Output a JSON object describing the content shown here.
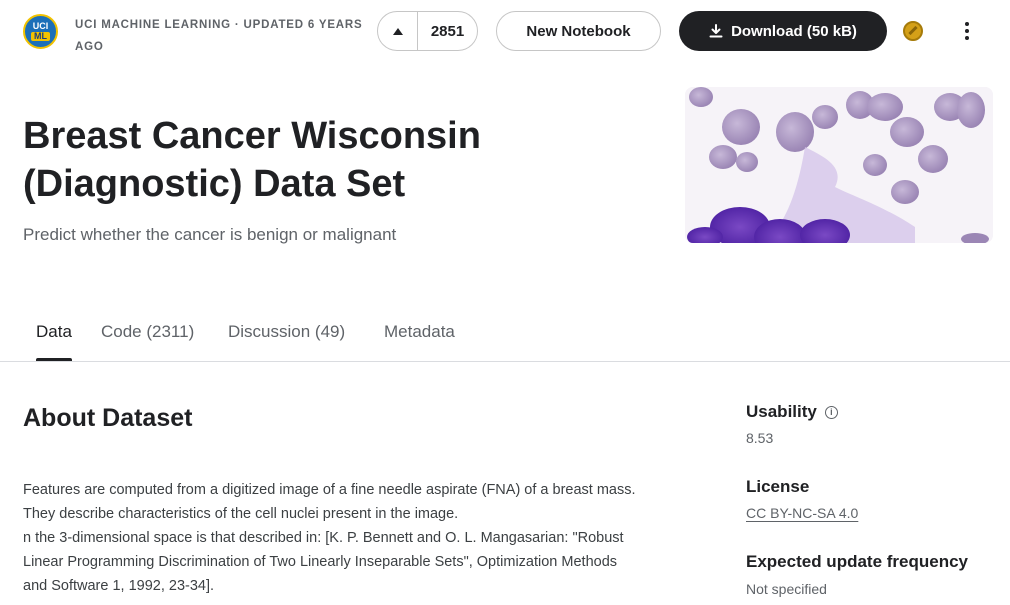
{
  "header": {
    "owner_avatar": {
      "line1": "UCI",
      "line2": "ML"
    },
    "owner_line": "UCI MACHINE LEARNING · UPDATED 6 YEARS AGO",
    "upvote_count": "2851",
    "new_notebook_label": "New Notebook",
    "download_label": "Download (50 kB)"
  },
  "dataset": {
    "title": "Breast Cancer Wisconsin (Diagnostic) Data Set",
    "subtitle": "Predict whether the cancer is benign or malignant"
  },
  "tabs": [
    {
      "label": "Data",
      "active": true
    },
    {
      "label": "Code (2311)",
      "active": false
    },
    {
      "label": "Discussion (49)",
      "active": false
    },
    {
      "label": "Metadata",
      "active": false
    }
  ],
  "about": {
    "heading": "About Dataset",
    "lines": [
      "Features are computed from a digitized image of a fine needle aspirate (FNA) of a breast mass.",
      "They describe characteristics of the cell nuclei present in the image.",
      "n the 3-dimensional space is that described in: [K. P. Bennett and O. L. Mangasarian: \"Robust",
      "Linear Programming Discrimination of Two Linearly Inseparable Sets\", Optimization Methods",
      "and Software 1, 1992, 23-34]."
    ]
  },
  "sidebar": {
    "usability_label": "Usability",
    "usability_value": "8.53",
    "license_label": "License",
    "license_value": "CC BY-NC-SA 4.0",
    "update_label": "Expected update frequency",
    "update_value": "Not specified"
  },
  "colors": {
    "primary_dark": "#202124",
    "muted_text": "#5f6368",
    "border": "#dadce0"
  },
  "icons": [
    "uci-ml-avatar",
    "upvote-icon",
    "download-icon",
    "medal-icon",
    "more-vert-icon",
    "info-icon"
  ]
}
